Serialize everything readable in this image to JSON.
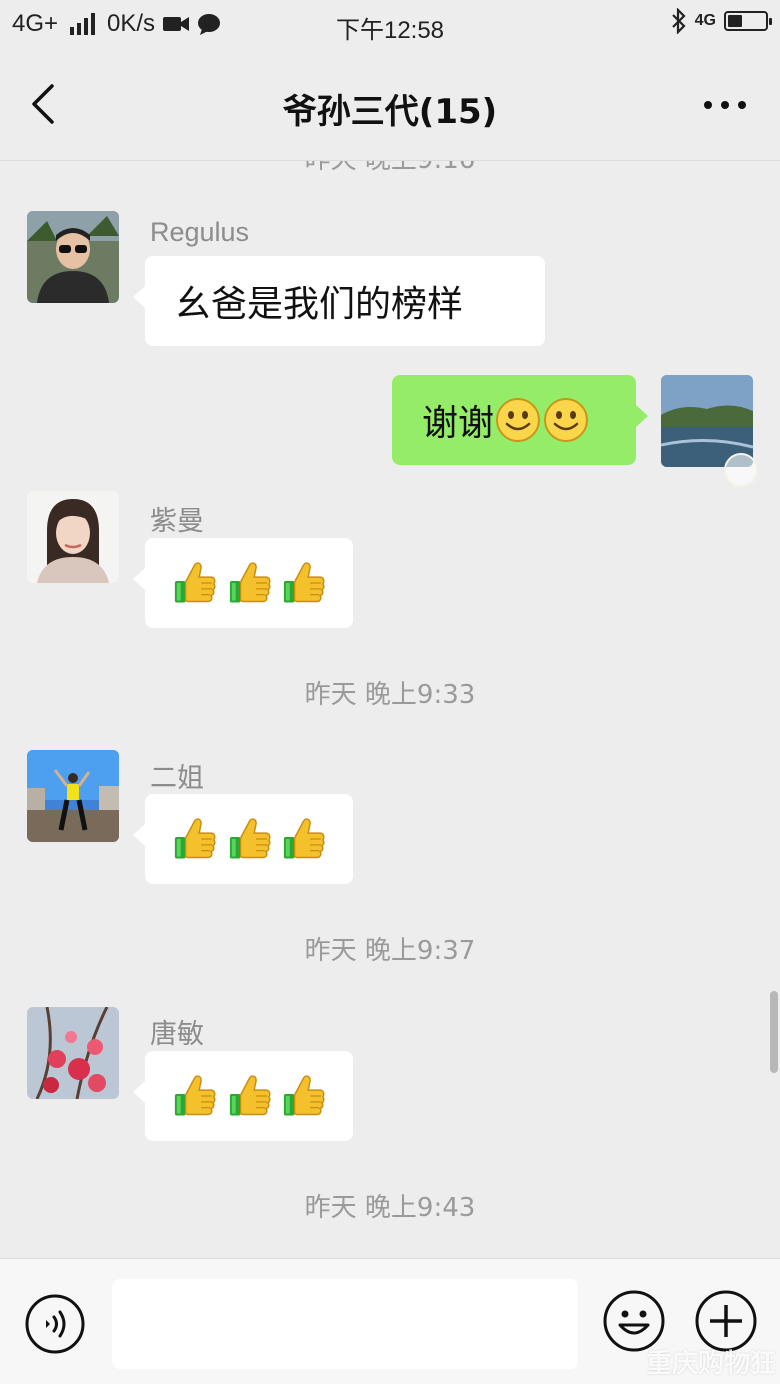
{
  "status": {
    "network": "4G+",
    "speed": "0K/s",
    "time": "下午12:58",
    "network_right": "4G",
    "battery_level": 0.4
  },
  "header": {
    "title": "爷孙三代(15)",
    "back_icon": "chevron-left-icon",
    "more_icon": "more-dots-icon"
  },
  "messages": [
    {
      "type": "text",
      "side": "left",
      "sender": "Regulus",
      "text": "幺爸是我们的榜样",
      "avatar": "avatar-man-sunglasses"
    },
    {
      "type": "text",
      "side": "right",
      "text": "谢谢",
      "emojis": [
        "smile-emoji",
        "smile-emoji"
      ],
      "avatar": "avatar-landscape-lake"
    },
    {
      "type": "emoji",
      "side": "left",
      "sender": "紫曼",
      "emojis": [
        "thumbs-up",
        "thumbs-up",
        "thumbs-up"
      ],
      "avatar": "avatar-woman-portrait"
    },
    {
      "type": "timestamp",
      "text": "昨天 晚上9:33"
    },
    {
      "type": "emoji",
      "side": "left",
      "sender": "二姐",
      "emojis": [
        "thumbs-up",
        "thumbs-up",
        "thumbs-up"
      ],
      "avatar": "avatar-dancer-street"
    },
    {
      "type": "timestamp",
      "text": "昨天 晚上9:37"
    },
    {
      "type": "emoji",
      "side": "left",
      "sender": "唐敏",
      "emojis": [
        "thumbs-up",
        "thumbs-up",
        "thumbs-up"
      ],
      "avatar": "avatar-red-flowers"
    },
    {
      "type": "timestamp",
      "text": "昨天 晚上9:43"
    }
  ],
  "input": {
    "value": "",
    "voice_icon": "voice-icon",
    "emoji_icon": "emoji-icon",
    "plus_icon": "plus-icon"
  },
  "watermark": "重庆购物狂"
}
